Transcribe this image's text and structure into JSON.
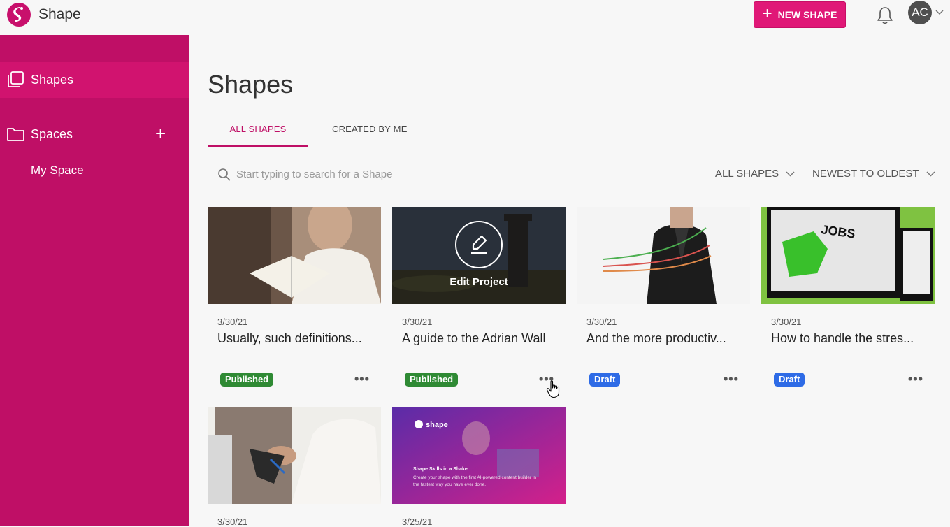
{
  "app": {
    "brand": "Shape",
    "new_button": "NEW SHAPE",
    "avatar_initials": "AC"
  },
  "sidebar": {
    "items": [
      {
        "label": "Shapes"
      },
      {
        "label": "Spaces"
      }
    ],
    "sub_items": [
      {
        "label": "My Space"
      }
    ]
  },
  "main": {
    "title": "Shapes",
    "tabs": [
      {
        "label": "ALL SHAPES"
      },
      {
        "label": "CREATED BY ME"
      }
    ],
    "search": {
      "placeholder": "Start typing to search for a Shape",
      "value": ""
    },
    "filters": {
      "type": "ALL SHAPES",
      "sort": "NEWEST TO OLDEST"
    }
  },
  "cards": [
    {
      "date": "3/30/21",
      "title": "Usually, such definitions...",
      "status": "Published"
    },
    {
      "date": "3/30/21",
      "title": "A guide to the Adrian Wall",
      "status": "Published",
      "hover_label": "Edit Project"
    },
    {
      "date": "3/30/21",
      "title": "And the more productiv...",
      "status": "Draft"
    },
    {
      "date": "3/30/21",
      "title": "How to handle the stres...",
      "status": "Draft"
    },
    {
      "date": "3/30/21"
    },
    {
      "date": "3/25/21",
      "thumb_brand": "shape",
      "thumb_heading": "Shape Skills in a Shake",
      "thumb_text": "Create your shape with the first AI-powered content builder in the fastest way you have ever done."
    }
  ],
  "colors": {
    "brand": "#bf0f66",
    "accent": "#e01877",
    "published": "#2f8a34",
    "draft": "#2e6be6"
  }
}
